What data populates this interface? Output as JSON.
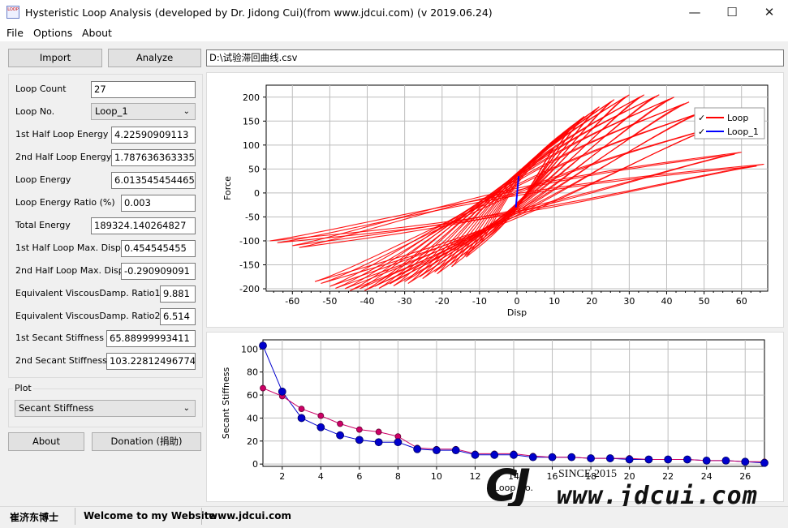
{
  "window": {
    "title": "Hysteristic Loop Analysis (developed by Dr. Jidong Cui)(from www.jdcui.com) (v 2019.06.24)",
    "icon_label": "LOOP",
    "minimize_glyph": "—",
    "maximize_glyph": "☐",
    "close_glyph": "✕"
  },
  "menu": {
    "file": "File",
    "options": "Options",
    "about": "About"
  },
  "toolbar": {
    "import_label": "Import",
    "analyze_label": "Analyze",
    "file_path": "D:\\试验滞回曲线.csv"
  },
  "params": {
    "loop_count_label": "Loop Count",
    "loop_count_value": "27",
    "loop_no_label": "Loop No.",
    "loop_no_value": "Loop_1",
    "first_half_energy_label": "1st Half Loop Energy",
    "first_half_energy_value": "4.22590909113",
    "second_half_energy_label": "2nd Half Loop Energy",
    "second_half_energy_value": "1.787636363335",
    "loop_energy_label": "Loop Energy",
    "loop_energy_value": "6.013545454465",
    "loop_energy_ratio_label": "Loop Energy Ratio (%)",
    "loop_energy_ratio_value": "0.003",
    "total_energy_label": "Total Energy",
    "total_energy_value": "189324.140264827",
    "first_half_max_disp_label": "1st Half Loop Max. Disp",
    "first_half_max_disp_value": "0.454545455",
    "second_half_max_disp_label": "2nd Half Loop Max. Disp",
    "second_half_max_disp_value": "-0.290909091",
    "eq_damp1_label": "Equivalent ViscousDamp. Ratio1 (%)",
    "eq_damp1_value": "9.881",
    "eq_damp2_label": "Equivalent ViscousDamp. Ratio2 (%)",
    "eq_damp2_value": "6.514",
    "first_secant_label": "1st Secant Stiffness",
    "first_secant_value": "65.88999993411",
    "second_secant_label": "2nd Secant Stiffness",
    "second_secant_value": "103.228124967741"
  },
  "plot_group": {
    "label": "Plot",
    "selected": "Secant Stiffness"
  },
  "buttons": {
    "about_label": "About",
    "donation_label": "Donation (捐助)"
  },
  "status": {
    "author": "崔济东博士",
    "welcome": "Welcome to my Website",
    "site": "www.jdcui.com"
  },
  "watermark": {
    "since": "SINCE 2015",
    "url": "www.jdcui.com"
  },
  "colors": {
    "loop": "#ff0000",
    "loop_1": "#0000ff",
    "secant_1": "#0000cc",
    "secant_2": "#cc0066",
    "grid": "#bdbdbd"
  },
  "chart_data": [
    {
      "type": "line",
      "title": "",
      "xlabel": "Disp",
      "ylabel": "Force",
      "xlim": [
        -67,
        67
      ],
      "ylim": [
        -205,
        225
      ],
      "x_ticks": [
        -60,
        -50,
        -40,
        -30,
        -20,
        -10,
        0,
        10,
        20,
        30,
        40,
        50,
        60
      ],
      "y_ticks": [
        -200,
        -150,
        -100,
        -50,
        0,
        50,
        100,
        150,
        200
      ],
      "legend": {
        "position": "top-right",
        "entries": [
          "Loop",
          "Loop_1"
        ]
      },
      "grid": true,
      "series": [
        {
          "name": "Loop",
          "loop_count": 27,
          "amplitudes_disp": [
            10,
            14,
            18,
            22,
            26,
            30,
            34,
            38,
            42,
            46,
            50,
            54,
            60,
            66
          ],
          "peak_force_pos": [
            95,
            130,
            160,
            180,
            195,
            205,
            205,
            205,
            200,
            190,
            170,
            140,
            85,
            60
          ],
          "peak_force_neg": [
            -100,
            -130,
            -150,
            -165,
            -175,
            -185,
            -190,
            -195,
            -200,
            -200,
            -195,
            -185,
            -110,
            -100
          ]
        },
        {
          "name": "Loop_1",
          "x": [
            0.45,
            -0.29
          ],
          "y": [
            35,
            -30
          ]
        }
      ]
    },
    {
      "type": "line",
      "title": "",
      "xlabel": "Loop No.",
      "ylabel": "Secant Stiffness",
      "xlim": [
        1,
        27
      ],
      "ylim": [
        -2,
        108
      ],
      "x_ticks": [
        2,
        4,
        6,
        8,
        10,
        12,
        14,
        16,
        18,
        20,
        22,
        24,
        26
      ],
      "y_ticks": [
        0,
        20,
        40,
        60,
        80,
        100
      ],
      "grid": true,
      "x": [
        1,
        2,
        3,
        4,
        5,
        6,
        7,
        8,
        9,
        10,
        11,
        12,
        13,
        14,
        15,
        16,
        17,
        18,
        19,
        20,
        21,
        22,
        23,
        24,
        25,
        26,
        27
      ],
      "series": [
        {
          "values": [
            103,
            63,
            40,
            32,
            25,
            21,
            19,
            19,
            13,
            12,
            12,
            8,
            8,
            8,
            6,
            6,
            6,
            5,
            5,
            4,
            4,
            4,
            4,
            3,
            3,
            2,
            1
          ]
        },
        {
          "values": [
            66,
            59,
            48,
            42,
            35,
            30,
            28,
            24,
            14,
            13,
            13,
            9,
            9,
            9,
            7,
            6,
            6,
            5,
            5,
            5,
            4,
            4,
            4,
            3,
            3,
            2,
            2
          ]
        }
      ]
    }
  ]
}
